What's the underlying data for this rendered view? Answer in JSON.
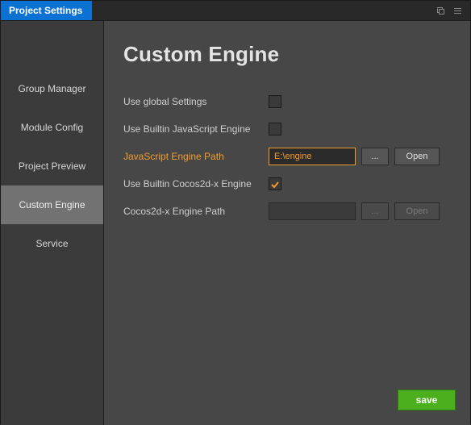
{
  "titlebar": {
    "title": "Project Settings"
  },
  "sidebar": {
    "items": [
      {
        "label": "Group Manager"
      },
      {
        "label": "Module Config"
      },
      {
        "label": "Project Preview"
      },
      {
        "label": "Custom Engine"
      },
      {
        "label": "Service"
      }
    ],
    "active_index": 3
  },
  "content": {
    "heading": "Custom Engine",
    "rows": {
      "use_global": {
        "label": "Use global Settings",
        "checked": false
      },
      "use_builtin_js": {
        "label": "Use Builtin JavaScript Engine",
        "checked": false
      },
      "js_path": {
        "label": "JavaScript Engine Path",
        "value": "E:\\engine",
        "browse_label": "...",
        "open_label": "Open",
        "enabled": true
      },
      "use_builtin_cocos": {
        "label": "Use Builtin Cocos2d-x Engine",
        "checked": true
      },
      "cocos_path": {
        "label": "Cocos2d-x Engine Path",
        "value": "",
        "browse_label": "...",
        "open_label": "Open",
        "enabled": false
      }
    },
    "save_label": "save"
  }
}
